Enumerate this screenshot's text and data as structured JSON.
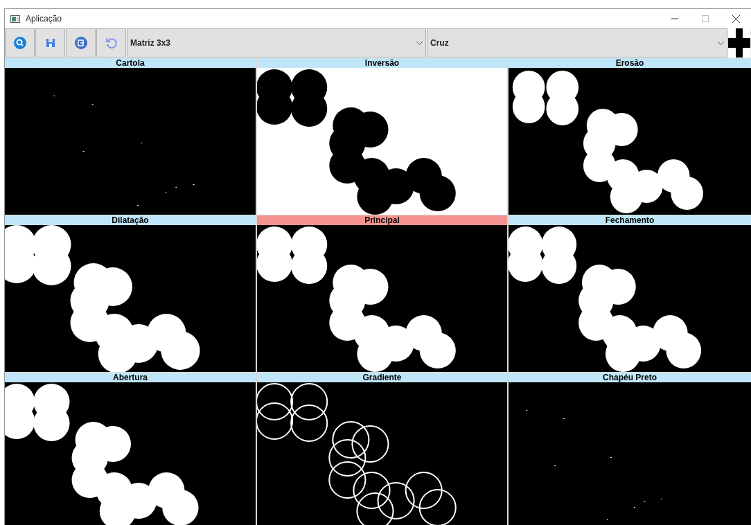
{
  "window": {
    "title": "Aplicação"
  },
  "toolbar": {
    "buttons": [
      {
        "kind": "search"
      },
      {
        "kind": "save"
      },
      {
        "kind": "export"
      },
      {
        "kind": "undo"
      }
    ],
    "dropdowns": [
      {
        "value": "Matriz 3x3"
      },
      {
        "value": "Cruz"
      }
    ]
  },
  "panels": [
    {
      "title": "Cartola",
      "selected": false,
      "kind": "picture"
    },
    {
      "title": "Inversão",
      "selected": false,
      "kind": "picture"
    },
    {
      "title": "Erosão",
      "selected": false,
      "kind": "picture"
    },
    {
      "title": "Dilatação",
      "selected": false,
      "kind": "picture"
    },
    {
      "title": "Principal",
      "selected": true,
      "kind": "picture"
    },
    {
      "title": "Fechamento",
      "selected": false,
      "kind": "picture"
    },
    {
      "title": "Abertura",
      "selected": false,
      "kind": "picture"
    },
    {
      "title": "Gradiente",
      "selected": false,
      "kind": "picture"
    },
    {
      "title": "Chapéu Preto",
      "selected": false,
      "kind": "picture"
    }
  ]
}
